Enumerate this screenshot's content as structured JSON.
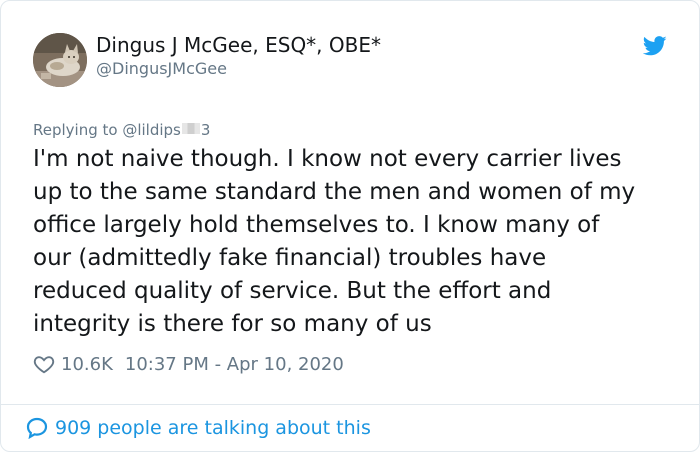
{
  "user": {
    "display_name": "Dingus J McGee, ESQ*, OBE*",
    "handle": "@DingusJMcGee",
    "avatar_icon": "cat-photo-avatar"
  },
  "reply": {
    "prefix": "Replying to ",
    "handle_start": "@lildips",
    "handle_end": "3"
  },
  "tweet": {
    "lines": [
      "I'm not naive though. I know not every carrier lives",
      "up to the same standard the men and women of my",
      "office largely hold themselves to. I know many of",
      "our (admittedly fake financial) troubles have",
      "reduced quality of service. But the effort and",
      "integrity is there for so many of us"
    ]
  },
  "meta": {
    "likes": "10.6K",
    "timestamp": "10:37 PM - Apr 10, 2020",
    "like_icon": "heart-icon"
  },
  "footer": {
    "talking": "909 people are talking about this",
    "icon": "speech-bubble-icon"
  },
  "colors": {
    "text": "#14171a",
    "secondary": "#657786",
    "accent": "#1b95e0",
    "twitter_blue": "#1da1f2",
    "border": "#e1e8ed"
  }
}
